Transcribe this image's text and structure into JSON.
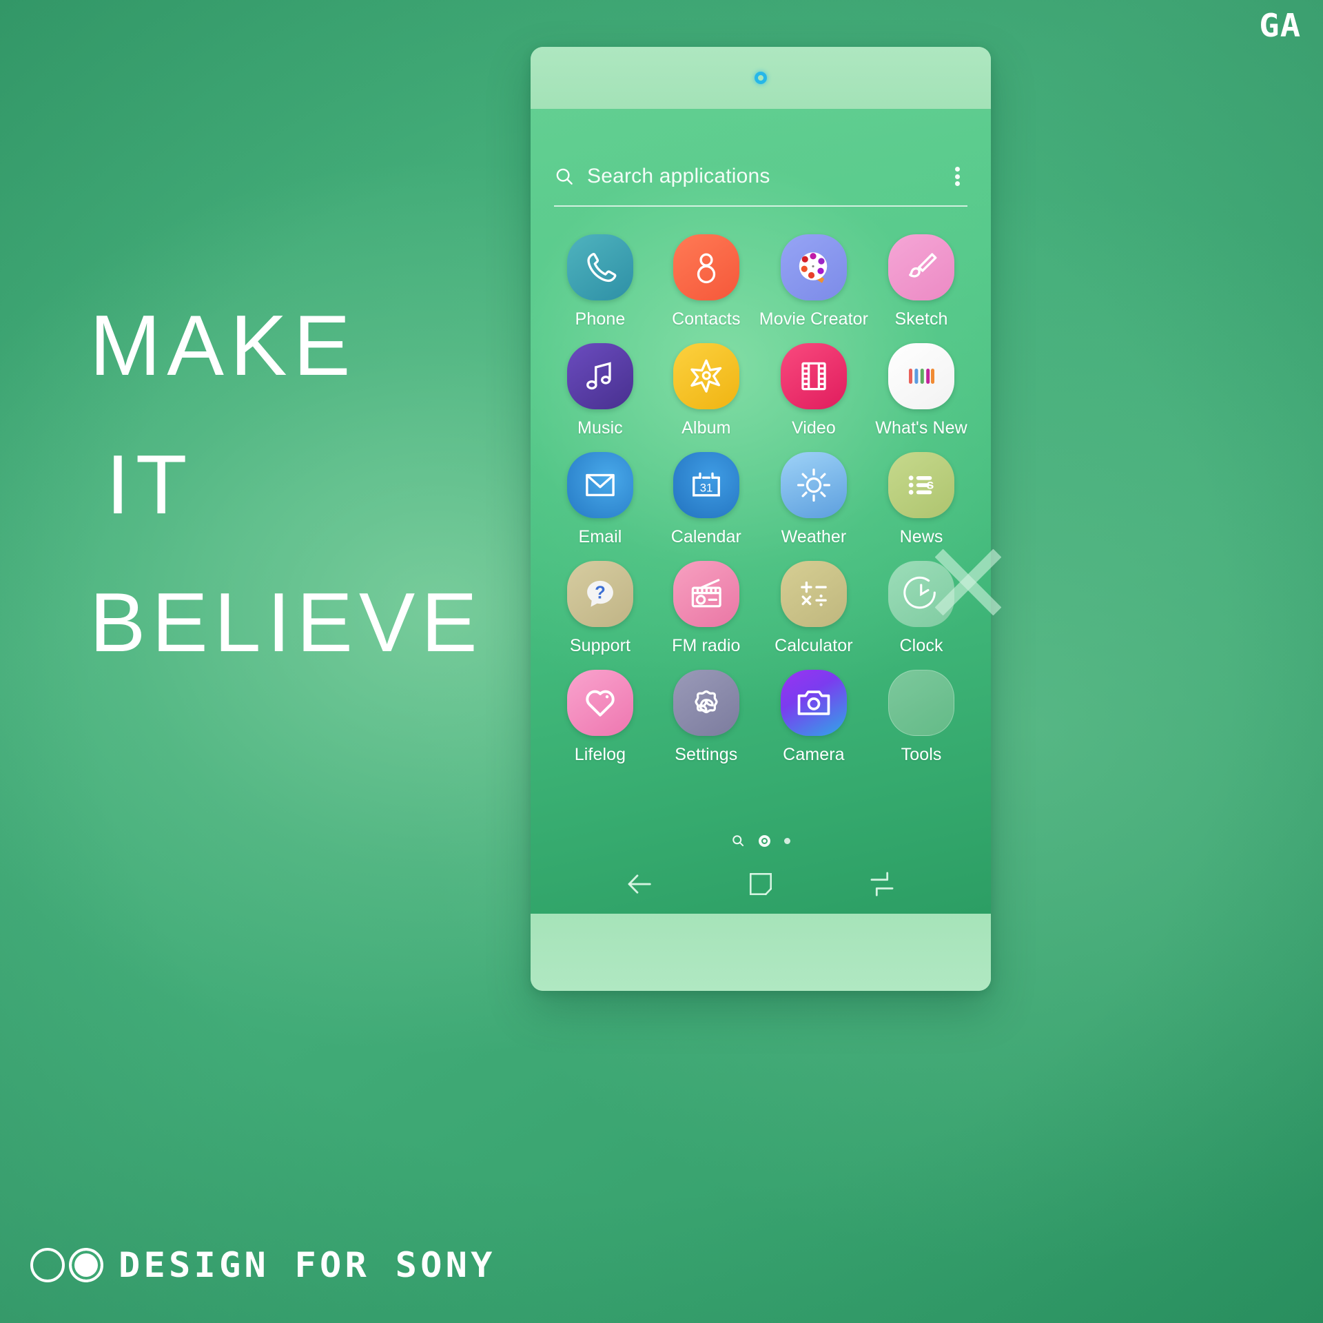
{
  "brand": {
    "logo": "GA",
    "footer_text": "DESIGN FOR SONY"
  },
  "headline": {
    "line1": "MAKE",
    "line2": "IT",
    "line3": "BELIEVE"
  },
  "colors": {
    "background": "#3DA873",
    "screen_green": "#56C98B",
    "bezel": "#A5E3B8",
    "camera_ring": "#26B7E8",
    "label_text": "#FFFFFF"
  },
  "phone": {
    "search": {
      "placeholder": "Search applications",
      "value": "",
      "search_icon": "search-icon",
      "menu_icon": "overflow-menu-icon"
    },
    "apps": [
      {
        "label": "Phone",
        "icon": "phone-handset-icon",
        "bg": "#3FA8B5",
        "bg2": "#2F93A8",
        "fg": "#FFFFFF"
      },
      {
        "label": "Contacts",
        "icon": "person-icon",
        "bg": "#FF6B4A",
        "bg2": "#F85C38",
        "fg": "#FFFFFF"
      },
      {
        "label": "Movie Creator",
        "icon": "film-reel-icon",
        "bg": "#8C9BF0",
        "bg2": "#7E8DEA",
        "fg": "#FFFFFF"
      },
      {
        "label": "Sketch",
        "icon": "paintbrush-icon",
        "bg": "#F29DD0",
        "bg2": "#EE8FC8",
        "fg": "#FFFFFF"
      },
      {
        "label": "Music",
        "icon": "music-note-icon",
        "bg": "#5B3FA8",
        "bg2": "#4A3191",
        "fg": "#FFFFFF"
      },
      {
        "label": "Album",
        "icon": "star-burst-icon",
        "bg": "#F8C62B",
        "bg2": "#F2B81C",
        "fg": "#FFFFFF"
      },
      {
        "label": "Video",
        "icon": "film-strip-icon",
        "bg": "#F0336E",
        "bg2": "#E32461",
        "fg": "#FFFFFF"
      },
      {
        "label": "What's New",
        "icon": "color-bars-icon",
        "bg": "#FFFFFF",
        "bg2": "#F6F6F6",
        "fg": "#E0574F"
      },
      {
        "label": "Email",
        "icon": "envelope-icon",
        "bg": "#2F93E0",
        "bg2": "#2B86D2",
        "fg": "#FFFFFF"
      },
      {
        "label": "Calendar",
        "icon": "calendar-31-icon",
        "bg": "#2E8FDD",
        "bg2": "#2A7FCB",
        "fg": "#FFFFFF"
      },
      {
        "label": "Weather",
        "icon": "sun-icon",
        "bg": "#8AC4F2",
        "bg2": "#6FAEE6",
        "fg": "#FFFFFF"
      },
      {
        "label": "News",
        "icon": "news-list-s-icon",
        "bg": "#B9CE7E",
        "bg2": "#A9C06D",
        "fg": "#FFFFFF"
      },
      {
        "label": "Support",
        "icon": "question-bubble-icon",
        "bg": "#CFC69B",
        "bg2": "#C3B98C",
        "fg": "#3B6FD4"
      },
      {
        "label": "FM radio",
        "icon": "radio-icon",
        "bg": "#F291B5",
        "bg2": "#ED7FA8",
        "fg": "#FFFFFF"
      },
      {
        "label": "Calculator",
        "icon": "calculator-ops-icon",
        "bg": "#CCC58E",
        "bg2": "#BFB880",
        "fg": "#FFFFFF"
      },
      {
        "label": "Clock",
        "icon": "clock-face-icon",
        "bg": "#9FD3B0",
        "bg2": "#8FC7A2",
        "fg": "#FFFFFF"
      },
      {
        "label": "Lifelog",
        "icon": "heart-icon",
        "bg": "#F48FC0",
        "bg2": "#EE7BB2",
        "fg": "#FFFFFF"
      },
      {
        "label": "Settings",
        "icon": "settings-leaf-icon",
        "bg": "#8E8EB0",
        "bg2": "#7F7FA2",
        "fg": "#FFFFFF"
      },
      {
        "label": "Camera",
        "icon": "camera-icon",
        "bg": "#8B3FF0",
        "bg2": "#2FA8E8",
        "fg": "#FFFFFF"
      },
      {
        "label": "Tools",
        "icon": "empty-folder-icon",
        "bg": "#85C99B",
        "bg2": "#7CC193",
        "fg": "#FFFFFF"
      }
    ],
    "page_indicator": {
      "search_shortcut": "search-icon",
      "pages": 2,
      "active_index": 0
    },
    "nav": {
      "back": "back-arrow-icon",
      "home": "home-square-icon",
      "recents": "recents-icon"
    }
  }
}
